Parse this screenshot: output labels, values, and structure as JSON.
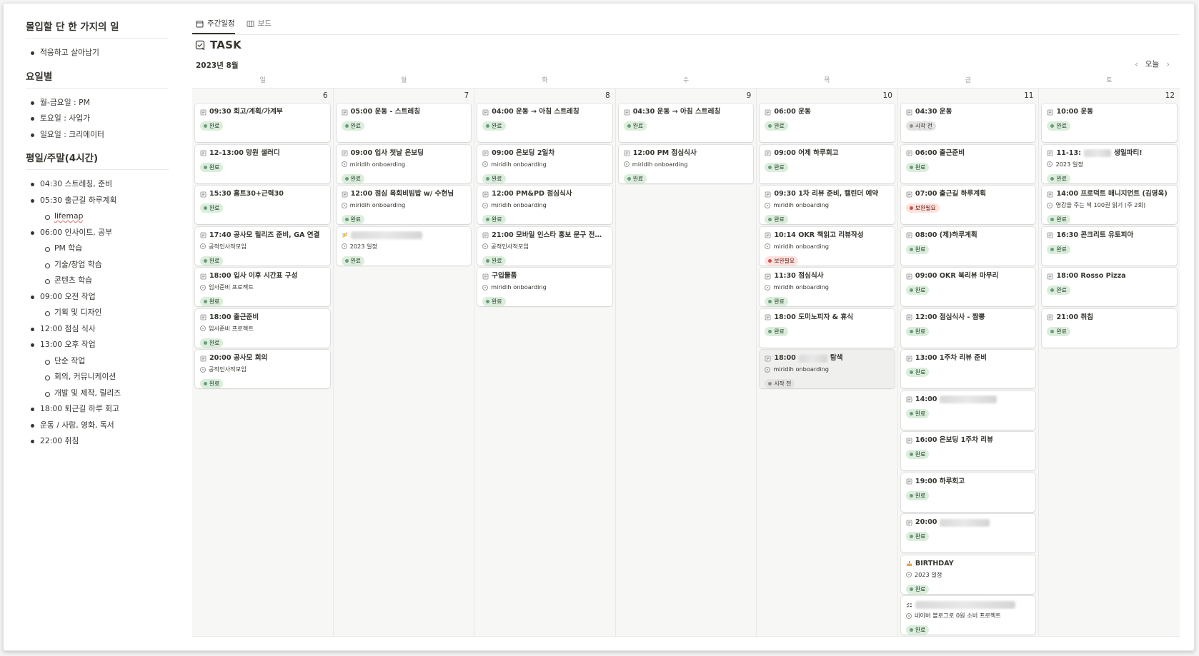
{
  "left": {
    "sections": [
      {
        "heading": "몰입할 단 한 가지의 일",
        "items": [
          {
            "text": "적응하고 살아남기",
            "level": 0
          }
        ]
      },
      {
        "heading": "요일별",
        "items": [
          {
            "text": "월-금요일 : PM",
            "level": 0
          },
          {
            "text": "토요일 : 사업가",
            "level": 0
          },
          {
            "text": "일요일 : 크리에이터",
            "level": 0
          }
        ]
      },
      {
        "heading": "평일/주말(4시간)",
        "items": [
          {
            "text": "04:30 스트레칭, 준비",
            "level": 0
          },
          {
            "text": "05:30 출근길 하루계획",
            "level": 0
          },
          {
            "text": "lifemap",
            "level": 1,
            "squiggle": true
          },
          {
            "text": "06:00 인사이트, 공부",
            "level": 0
          },
          {
            "text": "PM 학습",
            "level": 1
          },
          {
            "text": "기술/창업 학습",
            "level": 1
          },
          {
            "text": "콘텐츠 학습",
            "level": 1
          },
          {
            "text": "09:00 오전 작업",
            "level": 0
          },
          {
            "text": "기획 및 디자인",
            "level": 1
          },
          {
            "text": "12:00 점심 식사",
            "level": 0
          },
          {
            "text": "13:00 오후 작업",
            "level": 0
          },
          {
            "text": "단순 작업",
            "level": 1
          },
          {
            "text": "회의, 커뮤니케이션",
            "level": 1
          },
          {
            "text": "개발 및 제작, 릴리즈",
            "level": 1
          },
          {
            "text": "18:00 퇴근길 하루 회고",
            "level": 0
          },
          {
            "text": "운동 / 사람, 영화, 독서",
            "level": 0
          },
          {
            "text": "22:00 취침",
            "level": 0
          }
        ]
      }
    ]
  },
  "tabs": [
    {
      "label": "주간일정",
      "icon": "calendar-icon",
      "active": true
    },
    {
      "label": "보드",
      "icon": "board-icon",
      "active": false
    }
  ],
  "title": "TASK",
  "month": "2023년 8월",
  "nav": {
    "prev_icon": "chevron-left-icon",
    "today": "오늘",
    "next_icon": "chevron-right-icon"
  },
  "weekdays": [
    "일",
    "월",
    "화",
    "수",
    "목",
    "금",
    "토"
  ],
  "statuses": {
    "done": "완료",
    "todo": "시작 전",
    "fix": "보완필요"
  },
  "colors": {
    "done_bg": "#dbeddb",
    "done_dot": "#6c9b7d",
    "todo_bg": "#e3e2e0",
    "fix_bg": "#ffe2dd",
    "fix_dot": "#d44c47"
  },
  "days": [
    {
      "date": "6",
      "cards": [
        {
          "title": "09:30 회고/계획/가계부",
          "status": "done"
        },
        {
          "title": "12-13:00 망원 샐러디",
          "status": "done"
        },
        {
          "title": "15:30 홈트30+근력30",
          "status": "done"
        },
        {
          "title": "17:40 공사모 릴리즈 준비, GA 연결",
          "relation": "공적인사적모임",
          "status": "done"
        },
        {
          "title": "18:00 입사 이후 시간표 구성",
          "relation": "입사준비 프로젝트",
          "status": "done"
        },
        {
          "title": "18:00 출근준비",
          "relation": "입사준비 프로젝트",
          "status": "done"
        },
        {
          "title": "20:00 공사모 회의",
          "relation": "공적인사적모임",
          "status": "done"
        }
      ]
    },
    {
      "date": "7",
      "cards": [
        {
          "title": "05:00 운동 - 스트레칭",
          "status": "done"
        },
        {
          "title": "09:00 입사 첫날 온보딩",
          "relation": "miridih onboarding",
          "status": "done"
        },
        {
          "title": "12:00 점심 육회비빔밥 w/ 수현님",
          "relation": "miridih onboarding",
          "status": "done"
        },
        {
          "title": "",
          "icon": "party-icon",
          "blur": 100,
          "relation": "2023 일정",
          "status": "done"
        }
      ]
    },
    {
      "date": "8",
      "cards": [
        {
          "title": "04:00 운동 → 아침 스트레칭",
          "status": "done"
        },
        {
          "title": "09:00 온보딩 2일차",
          "relation": "miridih onboarding",
          "status": "done"
        },
        {
          "title": "12:00 PM&PD 점심식사",
          "relation": "miridih onboarding",
          "status": "done"
        },
        {
          "title": "21:00 모바일 인스타 홍보 문구 전달 to ...",
          "relation": "공적인사적모임",
          "status": "done"
        },
        {
          "title": "구입물품",
          "relation": "miridih onboarding",
          "status": "done"
        }
      ]
    },
    {
      "date": "9",
      "cards": [
        {
          "title": "04:30 운동 → 아침 스트레칭",
          "status": "done"
        },
        {
          "title": "12:00 PM 점심식사",
          "relation": "miridih onboarding",
          "status": "done"
        }
      ]
    },
    {
      "date": "10",
      "cards": [
        {
          "title": "06:00 운동",
          "status": "done"
        },
        {
          "title": "09:00 어제 하루회고",
          "status": "done"
        },
        {
          "title": "09:30 1차 리뷰 준비, 캘린더 예약",
          "relation": "miridih onboarding",
          "status": "done"
        },
        {
          "title": "10:14 OKR 책읽고 리뷰작성",
          "relation": "miridih onboarding",
          "status": "fix"
        },
        {
          "title": "11:30 점심식사",
          "relation": "miridih onboarding",
          "status": "done"
        },
        {
          "title": "18:00 도미노피자 & 휴식",
          "status": "done"
        },
        {
          "title": "18:00",
          "blur": 40,
          "suffix": "탐색",
          "relation": "miridih onboarding",
          "status": "todo",
          "highlight": true
        }
      ]
    },
    {
      "date": "11",
      "cards": [
        {
          "title": "04:30 운동",
          "status": "todo"
        },
        {
          "title": "06:00 출근준비",
          "status": "done"
        },
        {
          "title": "07:00 출근길 하루계획",
          "status": "fix"
        },
        {
          "title": "08:00 (제)하루계획",
          "status": "done"
        },
        {
          "title": "09:00 OKR 북리뷰 마무리",
          "status": "done"
        },
        {
          "title": "12:00 점심식사 - 짬뽕",
          "status": "done"
        },
        {
          "title": "13:00 1주차 리뷰 준비",
          "status": "done"
        },
        {
          "title": "14:00",
          "blur": 80,
          "status": "done"
        },
        {
          "title": "16:00 온보딩 1주차 리뷰",
          "status": "done"
        },
        {
          "title": "19:00 하루회고",
          "status": "done"
        },
        {
          "title": "20:00",
          "blur": 70,
          "status": "done"
        },
        {
          "title": "BIRTHDAY",
          "icon": "cake-icon",
          "relation": "2023 일정",
          "status": "done"
        },
        {
          "title": "",
          "icon": "checklist-icon",
          "blur": 140,
          "relation": "네이버 블로그로 0원 소비 프로젝트",
          "status": "done"
        }
      ]
    },
    {
      "date": "12",
      "cards": [
        {
          "title": "10:00 운동",
          "status": "done"
        },
        {
          "title": "11-13:",
          "blur": 38,
          "suffix": "생일파티!",
          "relation": "2023 일정",
          "status": "done"
        },
        {
          "title": "14:00 프로덕트 매니지먼트 (김영욱)",
          "relation": "영감을 주는 책 100권 읽기 (주 2회)",
          "status": "done"
        },
        {
          "title": "16:30 콘크리트 유토피아",
          "status": "done"
        },
        {
          "title": "18:00 Rosso Pizza",
          "status": "done"
        },
        {
          "title": "21:00 취침",
          "status": "done"
        }
      ]
    }
  ]
}
